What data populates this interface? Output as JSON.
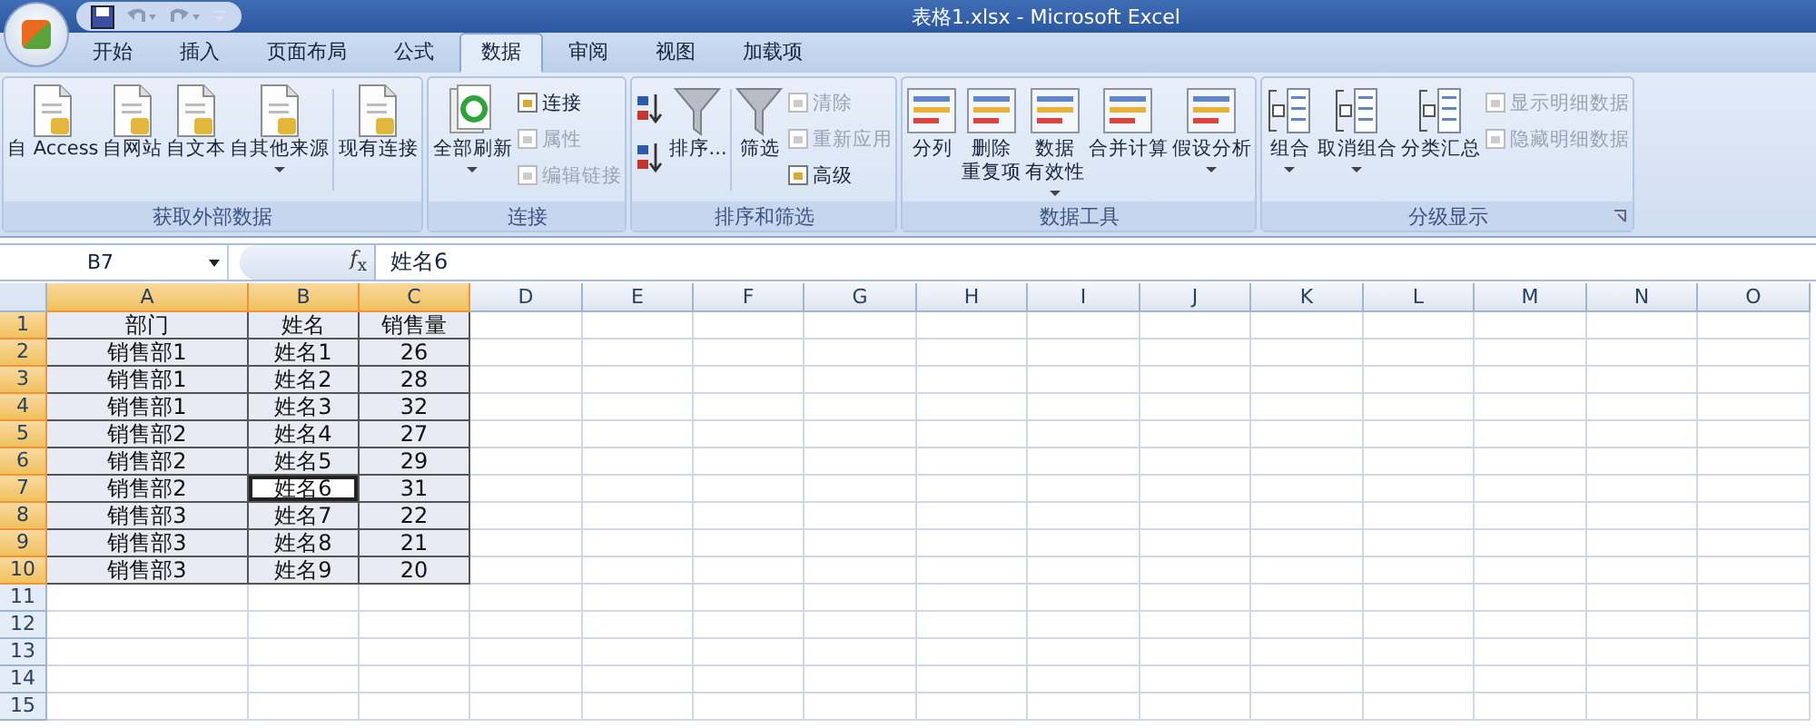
{
  "window": {
    "title": "表格1.xlsx - Microsoft Excel"
  },
  "tabs": [
    {
      "label": "开始",
      "selected": false
    },
    {
      "label": "插入",
      "selected": false
    },
    {
      "label": "页面布局",
      "selected": false
    },
    {
      "label": "公式",
      "selected": false
    },
    {
      "label": "数据",
      "selected": true
    },
    {
      "label": "审阅",
      "selected": false
    },
    {
      "label": "视图",
      "selected": false
    },
    {
      "label": "加载项",
      "selected": false
    }
  ],
  "ribbon_groups": [
    {
      "label": "获取外部数据",
      "launcher": false,
      "items": [
        {
          "kind": "large",
          "label": "自 Access",
          "dropdown": false
        },
        {
          "kind": "large",
          "label": "自网站",
          "dropdown": false
        },
        {
          "kind": "large",
          "label": "自文本",
          "dropdown": false
        },
        {
          "kind": "large",
          "label": "自其他来源",
          "dropdown": true
        },
        {
          "kind": "separator"
        },
        {
          "kind": "large",
          "label": "现有连接",
          "dropdown": false
        }
      ]
    },
    {
      "label": "连接",
      "launcher": false,
      "items": [
        {
          "kind": "large",
          "label": "全部刷新",
          "dropdown": true
        },
        {
          "kind": "stack",
          "buttons": [
            {
              "kind": "text",
              "label": "连接",
              "disabled": false
            },
            {
              "kind": "text",
              "label": "属性",
              "disabled": true
            },
            {
              "kind": "text",
              "label": "编辑链接",
              "disabled": true
            }
          ]
        }
      ]
    },
    {
      "label": "排序和筛选",
      "launcher": false,
      "items": [
        {
          "kind": "stack",
          "buttons": [
            {
              "kind": "icon"
            },
            {
              "kind": "icon"
            }
          ]
        },
        {
          "kind": "large",
          "label": "排序...",
          "dropdown": false
        },
        {
          "kind": "separator"
        },
        {
          "kind": "large",
          "label": "筛选",
          "dropdown": false
        },
        {
          "kind": "stack",
          "buttons": [
            {
              "kind": "text",
              "label": "清除",
              "disabled": true
            },
            {
              "kind": "text",
              "label": "重新应用",
              "disabled": true
            },
            {
              "kind": "text",
              "label": "高级",
              "disabled": false
            }
          ]
        }
      ]
    },
    {
      "label": "数据工具",
      "launcher": false,
      "items": [
        {
          "kind": "large",
          "label": "分列",
          "dropdown": false
        },
        {
          "kind": "large",
          "label": "删除",
          "label_2": "重复项",
          "dropdown": false
        },
        {
          "kind": "large",
          "label": "数据",
          "label_2": "有效性",
          "dropdown": true
        },
        {
          "kind": "large",
          "label": "合并计算",
          "dropdown": false
        },
        {
          "kind": "large",
          "label": "假设分析",
          "dropdown": true
        }
      ]
    },
    {
      "label": "分级显示",
      "launcher": true,
      "items": [
        {
          "kind": "large",
          "label": "组合",
          "dropdown": true
        },
        {
          "kind": "large",
          "label": "取消组合",
          "dropdown": true
        },
        {
          "kind": "large",
          "label": "分类汇总",
          "dropdown": false
        },
        {
          "kind": "stack",
          "buttons": [
            {
              "kind": "text",
              "label": "显示明细数据",
              "disabled": true
            },
            {
              "kind": "text",
              "label": "隐藏明细数据",
              "disabled": true
            }
          ]
        }
      ]
    }
  ],
  "formula_bar": {
    "name_box": "B7",
    "function_button": "*f*$_{x}$",
    "formula": "姓名6"
  },
  "columns": [
    {
      "label": "A",
      "selected": true
    },
    {
      "label": "B",
      "selected": true
    },
    {
      "label": "C",
      "selected": true
    },
    {
      "label": "D",
      "selected": false
    },
    {
      "label": "E",
      "selected": false
    },
    {
      "label": "F",
      "selected": false
    },
    {
      "label": "G",
      "selected": false
    },
    {
      "label": "H",
      "selected": false
    },
    {
      "label": "I",
      "selected": false
    },
    {
      "label": "J",
      "selected": false
    },
    {
      "label": "K",
      "selected": false
    },
    {
      "label": "L",
      "selected": false
    },
    {
      "label": "M",
      "selected": false
    },
    {
      "label": "N",
      "selected": false
    },
    {
      "label": "O",
      "selected": false
    }
  ],
  "rows": [
    {
      "label": "1",
      "selected": true,
      "cells": [
        {
          "text": "部门",
          "active": false
        },
        {
          "text": "姓名",
          "active": false
        },
        {
          "text": "销售量",
          "active": false
        }
      ]
    },
    {
      "label": "2",
      "selected": true,
      "cells": [
        {
          "text": "销售部1",
          "active": false
        },
        {
          "text": "姓名1",
          "active": false
        },
        {
          "text": "26",
          "active": false
        }
      ]
    },
    {
      "label": "3",
      "selected": true,
      "cells": [
        {
          "text": "销售部1",
          "active": false
        },
        {
          "text": "姓名2",
          "active": false
        },
        {
          "text": "28",
          "active": false
        }
      ]
    },
    {
      "label": "4",
      "selected": true,
      "cells": [
        {
          "text": "销售部1",
          "active": false
        },
        {
          "text": "姓名3",
          "active": false
        },
        {
          "text": "32",
          "active": false
        }
      ]
    },
    {
      "label": "5",
      "selected": true,
      "cells": [
        {
          "text": "销售部2",
          "active": false
        },
        {
          "text": "姓名4",
          "active": false
        },
        {
          "text": "27",
          "active": false
        }
      ]
    },
    {
      "label": "6",
      "selected": true,
      "cells": [
        {
          "text": "销售部2",
          "active": false
        },
        {
          "text": "姓名5",
          "active": false
        },
        {
          "text": "29",
          "active": false
        }
      ]
    },
    {
      "label": "7",
      "selected": true,
      "cells": [
        {
          "text": "销售部2",
          "active": false
        },
        {
          "text": "姓名6",
          "active": true
        },
        {
          "text": "31",
          "active": false
        }
      ]
    },
    {
      "label": "8",
      "selected": true,
      "cells": [
        {
          "text": "销售部3",
          "active": false
        },
        {
          "text": "姓名7",
          "active": false
        },
        {
          "text": "22",
          "active": false
        }
      ]
    },
    {
      "label": "9",
      "selected": true,
      "cells": [
        {
          "text": "销售部3",
          "active": false
        },
        {
          "text": "姓名8",
          "active": false
        },
        {
          "text": "21",
          "active": false
        }
      ]
    },
    {
      "label": "10",
      "selected": true,
      "cells": [
        {
          "text": "销售部3",
          "active": false
        },
        {
          "text": "姓名9",
          "active": false
        },
        {
          "text": "20",
          "active": false
        }
      ]
    },
    {
      "label": "11",
      "selected": false
    },
    {
      "label": "12",
      "selected": false
    },
    {
      "label": "13",
      "selected": false
    },
    {
      "label": "14",
      "selected": false
    },
    {
      "label": "15",
      "selected": false
    }
  ]
}
